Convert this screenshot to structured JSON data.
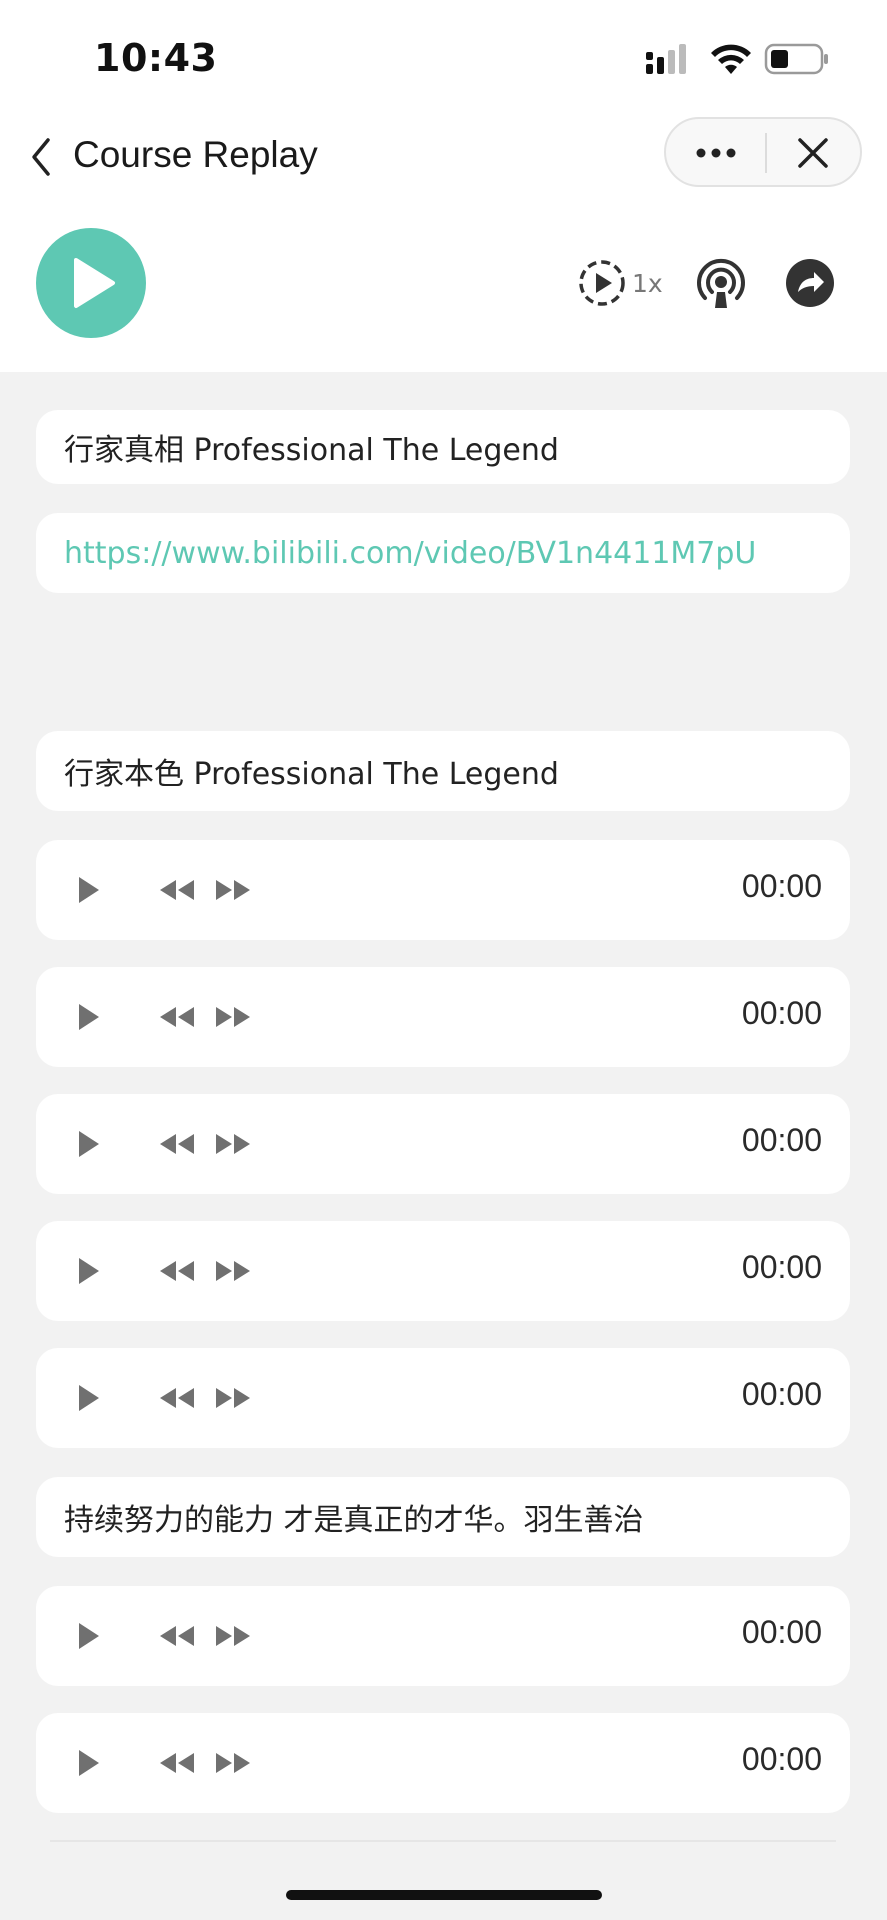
{
  "status_bar": {
    "time": "10:43"
  },
  "nav": {
    "title": "Course Replay"
  },
  "player": {
    "speed_label": "1x"
  },
  "items": {
    "title_1": "行家真相 Professional The Legend",
    "link_1": "https://www.bilibili.com/video/BV1n4411M7pU",
    "title_2": "行家本色 Professional The Legend",
    "audio_1_time": "00:00",
    "audio_2_time": "00:00",
    "audio_3_time": "00:00",
    "audio_4_time": "00:00",
    "audio_5_time": "00:00",
    "quote": "持续努力的能力 才是真正的才华。羽生善治",
    "audio_6_time": "00:00",
    "audio_7_time": "00:00"
  },
  "colors": {
    "accent": "#5ec8b3",
    "background": "#f2f2f2",
    "card": "#ffffff"
  },
  "icons": [
    "back-icon",
    "more-icon",
    "close-icon",
    "play-icon",
    "speed-icon",
    "podcast-icon",
    "share-icon",
    "rewind-icon",
    "fast-forward-icon"
  ]
}
